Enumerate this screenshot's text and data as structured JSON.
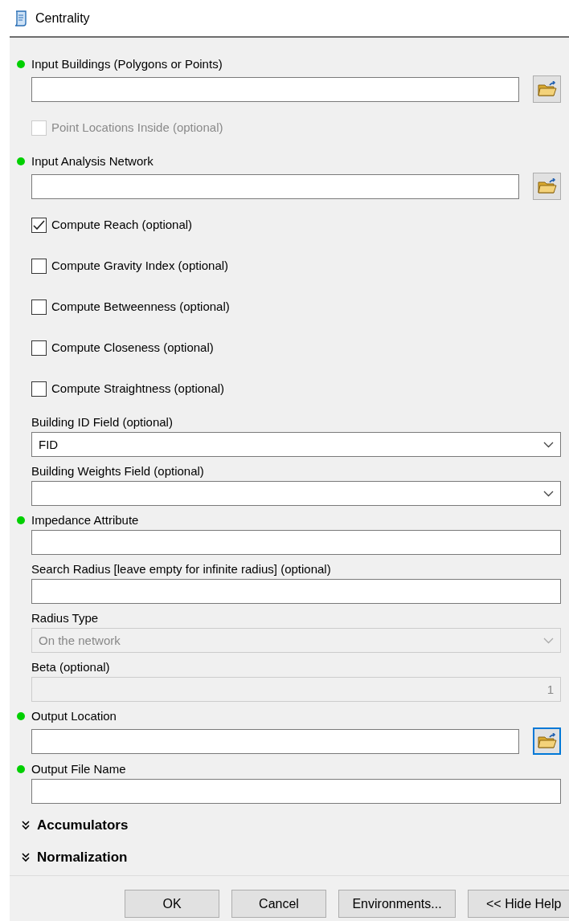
{
  "window": {
    "title": "Centrality"
  },
  "parameters": [
    {
      "kind": "browse",
      "label": "Input Buildings (Polygons or Points)",
      "required": true,
      "focused": false
    },
    {
      "kind": "checkbox",
      "label": "Point Locations Inside (optional)",
      "checked": false,
      "disabled": true
    },
    {
      "kind": "browse",
      "label": "Input Analysis Network",
      "required": true,
      "focused": false
    },
    {
      "kind": "checkbox",
      "label": "Compute Reach (optional)",
      "checked": true,
      "disabled": false
    },
    {
      "kind": "checkbox",
      "label": "Compute Gravity Index (optional)",
      "checked": false,
      "disabled": false
    },
    {
      "kind": "checkbox",
      "label": "Compute Betweenness (optional)",
      "checked": false,
      "disabled": false
    },
    {
      "kind": "checkbox",
      "label": "Compute Closeness (optional)",
      "checked": false,
      "disabled": false
    },
    {
      "kind": "checkbox",
      "label": "Compute Straightness (optional)",
      "checked": false,
      "disabled": false
    },
    {
      "kind": "select",
      "label": "Building ID Field (optional)",
      "required": false,
      "value": "FID",
      "disabled": false
    },
    {
      "kind": "select",
      "label": "Building Weights Field (optional)",
      "required": false,
      "disabled": false
    },
    {
      "kind": "text",
      "label": "Impedance Attribute",
      "required": true,
      "disabled": false
    },
    {
      "kind": "text",
      "label": "Search Radius [leave empty for infinite radius] (optional)",
      "required": false,
      "disabled": false
    },
    {
      "kind": "select",
      "label": "Radius Type",
      "required": false,
      "value": "On the network",
      "disabled": true
    },
    {
      "kind": "text",
      "label": "Beta (optional)",
      "required": false,
      "value": "1",
      "disabled": true
    },
    {
      "kind": "browse",
      "label": "Output Location",
      "required": true,
      "focused": true
    },
    {
      "kind": "text",
      "label": "Output File Name",
      "required": true,
      "disabled": false
    }
  ],
  "sections": [
    {
      "label": "Accumulators",
      "expanded": false
    },
    {
      "label": "Normalization",
      "expanded": false
    }
  ],
  "buttons": [
    "OK",
    "Cancel",
    "Environments...",
    "<< Hide Help"
  ]
}
